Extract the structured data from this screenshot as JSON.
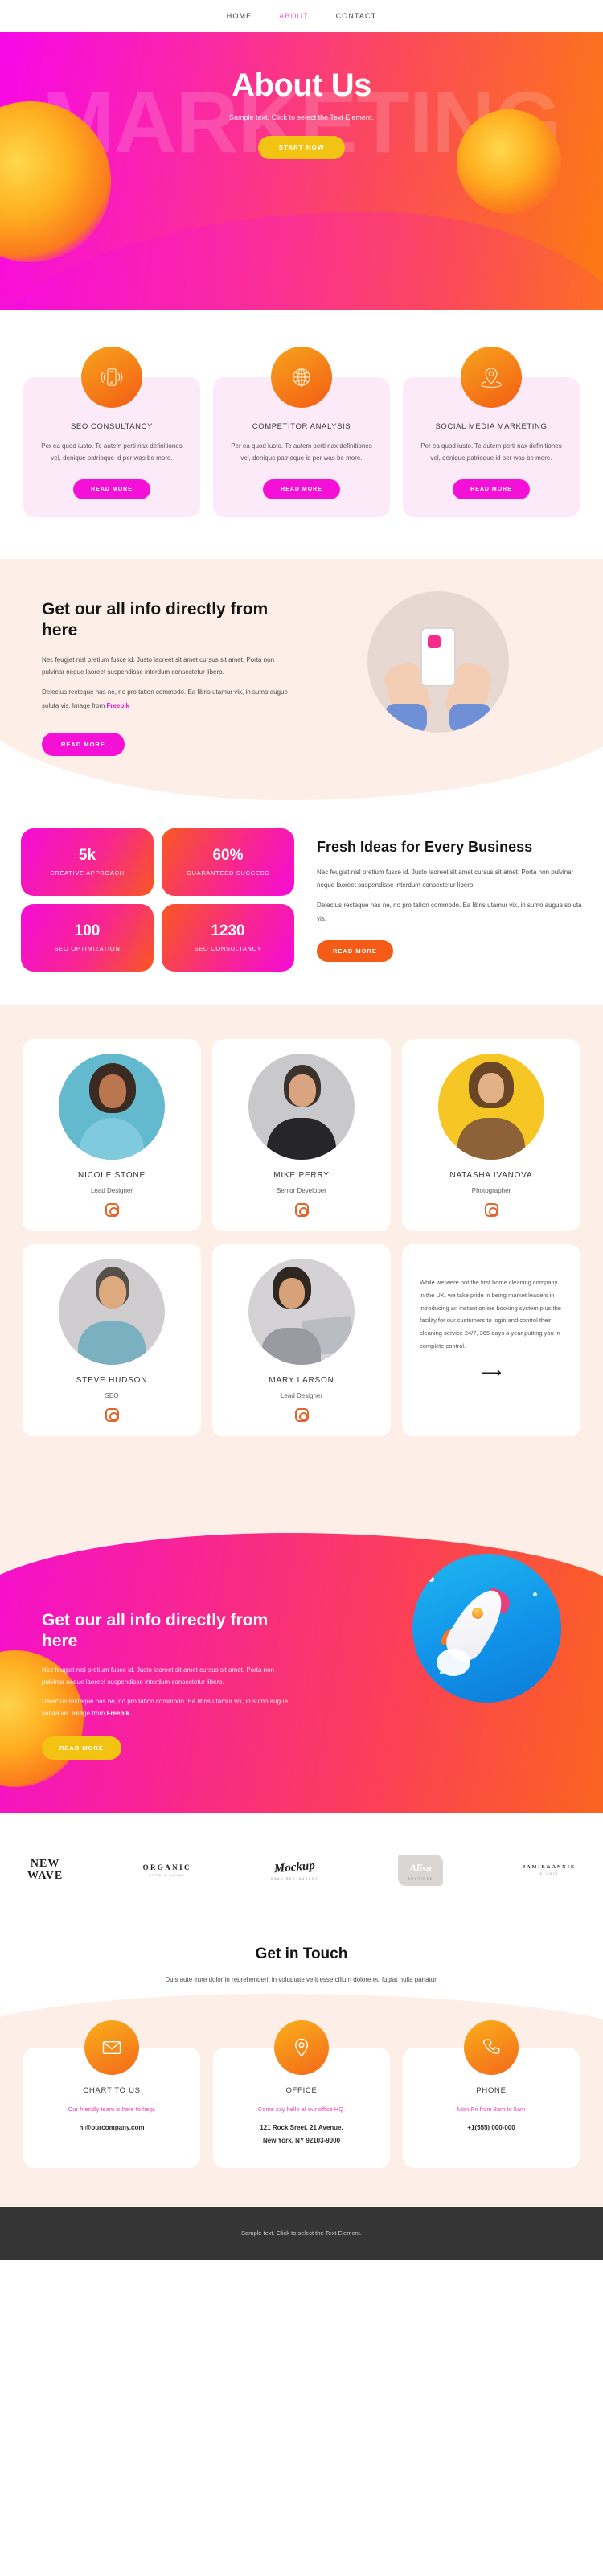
{
  "nav": {
    "items": [
      {
        "label": "HOME",
        "active": false
      },
      {
        "label": "ABOUT",
        "active": true
      },
      {
        "label": "CONTACT",
        "active": false
      }
    ]
  },
  "hero": {
    "watermark": "MARKETING",
    "title": "About Us",
    "subtitle": "Sample text. Click to select the Text Element.",
    "cta": "START NOW",
    "cta_color": "#f2c312",
    "gradient_from": "#f707e8",
    "gradient_to": "#fc7a12"
  },
  "services": {
    "cards": [
      {
        "icon": "mobile-signal-icon",
        "title": "SEO CONSULTANCY",
        "text": "Per ea quod iusto. Te autem perti nax definitiones vel, denique patrioque id per was be more.",
        "cta": "READ MORE"
      },
      {
        "icon": "globe-icon",
        "title": "COMPETITOR ANALYSIS",
        "text": "Per ea quod iusto. Te autem perti nax definitiones vel, denique patrioque id per was be more.",
        "cta": "READ MORE"
      },
      {
        "icon": "map-pin-icon",
        "title": "SOCIAL MEDIA MARKETING",
        "text": "Per ea quod iusto. Te autem perti nax definitiones vel, denique patrioque id per was be more.",
        "cta": "READ MORE"
      }
    ],
    "cta_color": "#f510d8"
  },
  "info": {
    "heading": "Get our all info directly from here",
    "paragraph1": "Nec feugiat nisl pretium fusce id. Justo laoreet sit amet cursus sit amet. Porta non pulvinar neque laoreet suspendisse interdum consectetur libero.",
    "paragraph2_pre": "Delectus recteque has ne, no pro tation commodo. Ea libris utamur vix, in sumo augue soluta vis. Image from ",
    "paragraph2_link": "Freepik",
    "cta": "READ MORE",
    "image_alt": "hands-holding-phone-illustration"
  },
  "stats": {
    "boxes": [
      {
        "number": "5k",
        "label": "CREATIVE APPROACH"
      },
      {
        "number": "60%",
        "label": "GUARANTEED SUCCESS"
      },
      {
        "number": "100",
        "label": "SEO OPTIMIZATION"
      },
      {
        "number": "1230",
        "label": "SEO CONSULTANCY"
      }
    ],
    "heading": "Fresh Ideas for Every Business",
    "paragraph1": "Nec feugiat nisl pretium fusce id. Justo laoreet sit amet cursus sit amet. Porta non pulvinar neque laoreet suspendisse interdum consectetur libero.",
    "paragraph2": "Delectus recteque has ne, no pro tation commodo. Ea libris utamur vix, in sumo augue soluta vis.",
    "cta": "READ MORE",
    "cta_color": "#f45b17"
  },
  "team": {
    "members": [
      {
        "name": "NICOLE STONE",
        "role": "Lead Designer",
        "photo_bg": "#63b9cd",
        "social": "instagram-icon"
      },
      {
        "name": "MIKE PERRY",
        "role": "Senior Developer",
        "photo_bg": "#c9c8cb",
        "social": "instagram-icon"
      },
      {
        "name": "NATASHA IVANOVA",
        "role": "Photographer",
        "photo_bg": "#f5c624",
        "social": "instagram-icon"
      },
      {
        "name": "STEVE HUDSON",
        "role": "SEO",
        "photo_bg": "#cfcdd0",
        "social": "instagram-icon"
      },
      {
        "name": "MARY LARSON",
        "role": "Lead Designer",
        "photo_bg": "#d4d2d5",
        "social": "instagram-icon"
      }
    ],
    "quote": "While we were not the first home cleaning company in the UK, we take pride in being market leaders in introducing an instant online booking system plus the facility for our customers to login and control their cleaning service 24/7, 365 days a year putting you in complete control.",
    "quote_arrow": "⟶"
  },
  "info2": {
    "heading": "Get our all info directly from here",
    "paragraph1": "Nec feugiat nisl pretium fusce id. Justo laoreet sit amet cursus sit amet. Porta non pulvinar neque laoreet suspendisse interdum consectetur libero.",
    "paragraph2_pre": "Delectus recteque has ne, no pro tation commodo. Ea libris utamur vix, in sumo augue soluta vis. Image from ",
    "paragraph2_link": "Freepik",
    "cta": "READ MORE",
    "cta_color": "#f2c312",
    "image_alt": "rocket-illustration"
  },
  "brands": [
    {
      "name": "NEW WAVE",
      "line1": "NEW",
      "line2": "WAVE",
      "sub": ""
    },
    {
      "name": "ORGANIC",
      "line1": "ORGANIC",
      "line2": "",
      "sub": "FOOD & DRINK"
    },
    {
      "name": "Mockup",
      "line1": "Mockup",
      "line2": "",
      "sub": "BAKE RESTAURANT"
    },
    {
      "name": "Alisa",
      "line1": "Alisa",
      "line2": "",
      "sub": "BOUTIQUE"
    },
    {
      "name": "JAMIE&ANNIE",
      "line1": "JAMIE&ANNIE",
      "line2": "",
      "sub": "STUDIO"
    }
  ],
  "contact": {
    "heading": "Get in Touch",
    "subtitle": "Duis aute irure dolor in reprehenderit in voluptate velit esse cillum dolore eu fugiat nulla pariatur.",
    "cards": [
      {
        "icon": "envelope-icon",
        "title": "CHART TO US",
        "note": "Our friendly team is here to help.",
        "value": "hi@ourcompany.com",
        "value2": ""
      },
      {
        "icon": "map-pin-icon",
        "title": "OFFICE",
        "note": "Come say hello at our office HQ.",
        "value": "121 Rock Sreet, 21 Avenue,",
        "value2": "New York, NY 92103-9000"
      },
      {
        "icon": "phone-icon",
        "title": "PHONE",
        "note": "Mon-Fri from 8am to 5am",
        "value": "+1(555) 000-000",
        "value2": ""
      }
    ],
    "note_color": "#ef3bbd"
  },
  "footer": {
    "text": "Sample text. Click to select the Text Element.",
    "bg": "#353535"
  }
}
